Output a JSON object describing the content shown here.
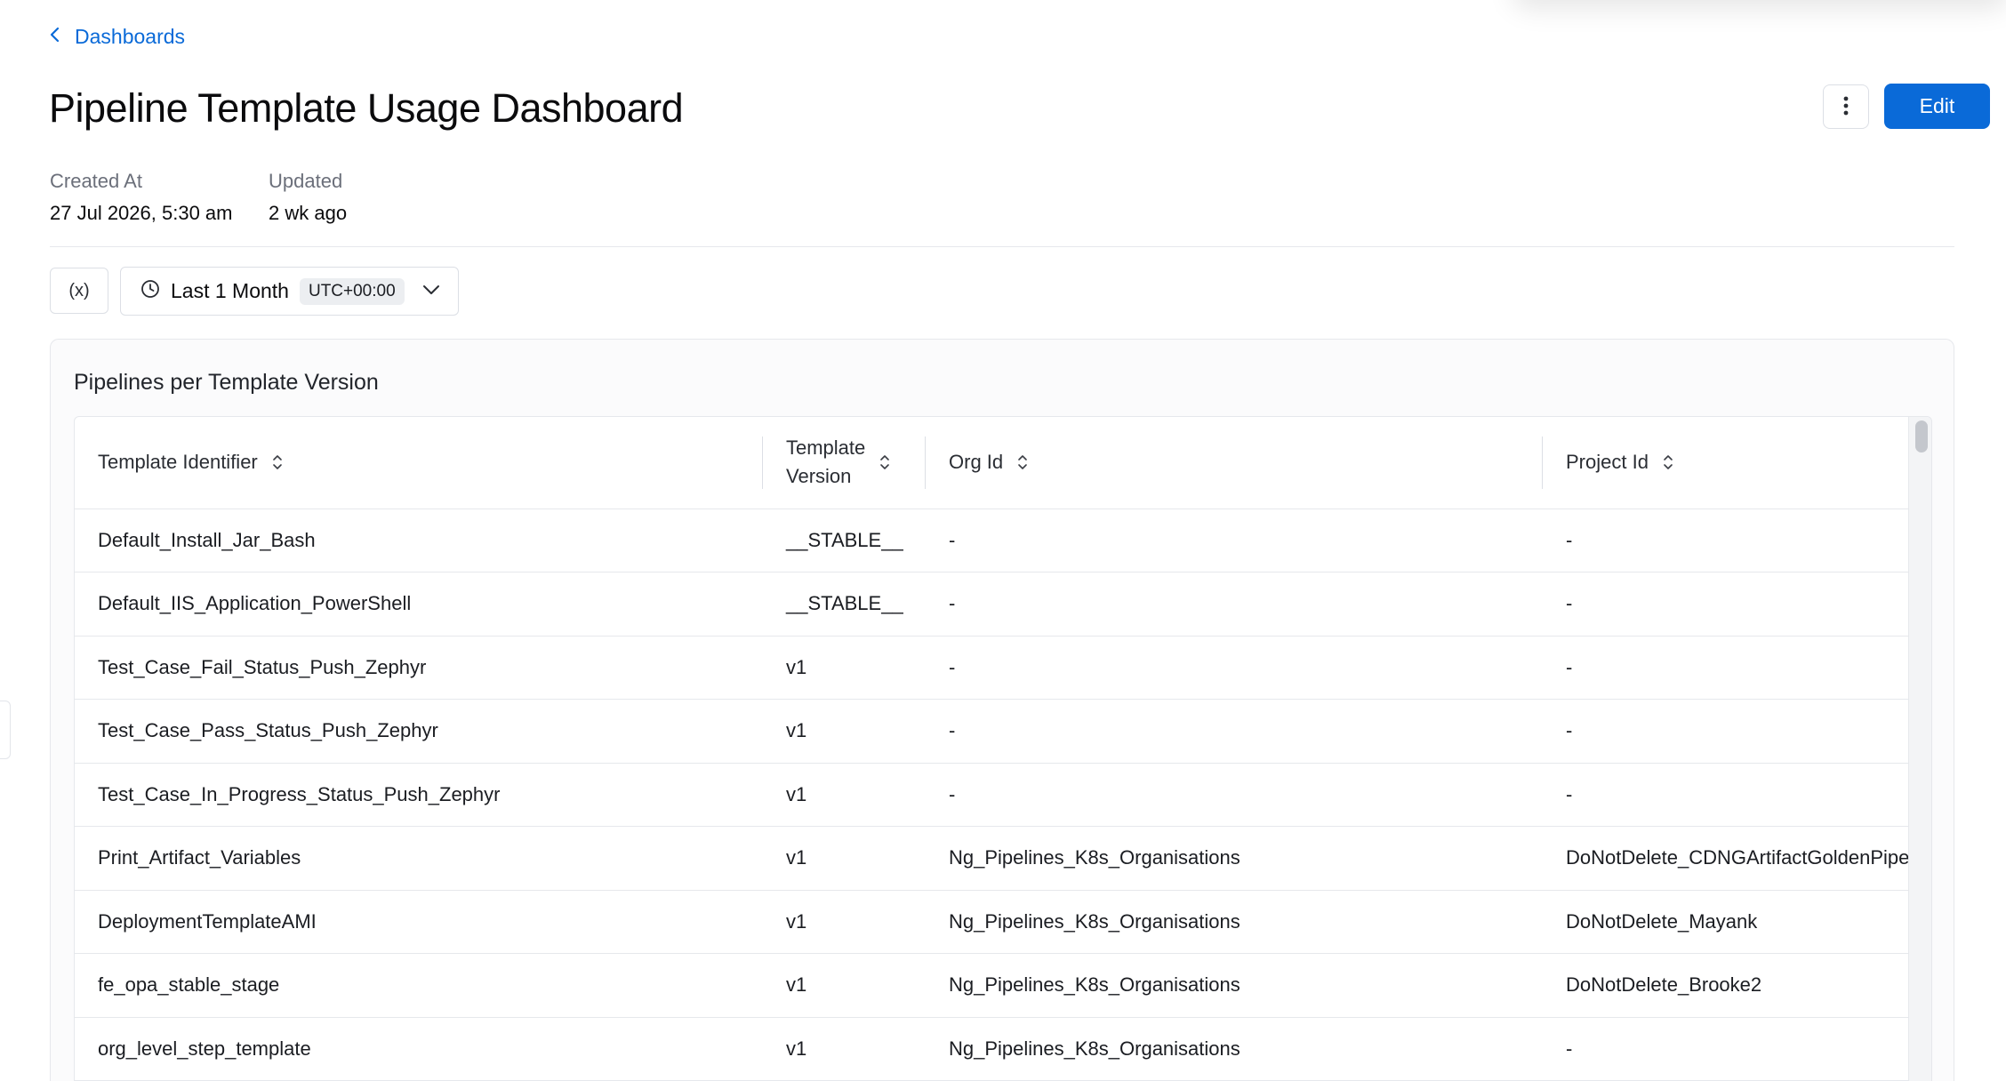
{
  "breadcrumb": {
    "label": "Dashboards"
  },
  "page": {
    "title": "Pipeline Template Usage Dashboard"
  },
  "actions": {
    "more_icon": "vertical-dots-icon",
    "edit_label": "Edit"
  },
  "meta": {
    "created_label": "Created At",
    "created_value": "27 Jul 2026, 5:30 am",
    "updated_label": "Updated",
    "updated_value": "2 wk ago"
  },
  "filters": {
    "variables_label": "(x)",
    "time_range": "Last 1 Month",
    "timezone": "UTC+00:00"
  },
  "widget": {
    "title": "Pipelines per Template Version",
    "columns": [
      {
        "line1": "Template Identifier",
        "line2": ""
      },
      {
        "line1": "Template",
        "line2": "Version"
      },
      {
        "line1": "Org Id",
        "line2": ""
      },
      {
        "line1": "Project Id",
        "line2": ""
      }
    ],
    "rows": [
      [
        "Default_Install_Jar_Bash",
        "__STABLE__",
        "-",
        "-"
      ],
      [
        "Default_IIS_Application_PowerShell",
        "__STABLE__",
        "-",
        "-"
      ],
      [
        "Test_Case_Fail_Status_Push_Zephyr",
        "v1",
        "-",
        "-"
      ],
      [
        "Test_Case_Pass_Status_Push_Zephyr",
        "v1",
        "-",
        "-"
      ],
      [
        "Test_Case_In_Progress_Status_Push_Zephyr",
        "v1",
        "-",
        "-"
      ],
      [
        "Print_Artifact_Variables",
        "v1",
        "Ng_Pipelines_K8s_Organisations",
        "DoNotDelete_CDNGArtifactGoldenPipelines"
      ],
      [
        "DeploymentTemplateAMI",
        "v1",
        "Ng_Pipelines_K8s_Organisations",
        "DoNotDelete_Mayank"
      ],
      [
        "fe_opa_stable_stage",
        "v1",
        "Ng_Pipelines_K8s_Organisations",
        "DoNotDelete_Brooke2"
      ],
      [
        "org_level_step_template",
        "v1",
        "Ng_Pipelines_K8s_Organisations",
        "-"
      ]
    ]
  },
  "colors": {
    "accent": "#0a6ad8",
    "border": "#e6e8ec",
    "muted_text": "#6b6f7a"
  }
}
